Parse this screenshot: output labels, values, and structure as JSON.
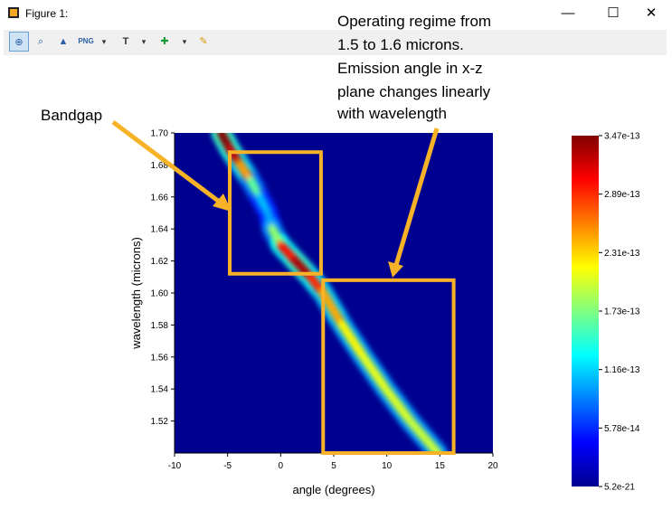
{
  "window": {
    "title": "Figure 1:",
    "minimize_glyph": "—",
    "maximize_glyph": "☐",
    "close_glyph": "✕"
  },
  "toolbar": {
    "buttons": [
      {
        "icon": "zoom-icon",
        "glyph": "⊕",
        "active": true
      },
      {
        "icon": "zoom-rect-icon",
        "glyph": "⌕",
        "active": false
      },
      {
        "icon": "mountain-icon",
        "glyph": "▲",
        "active": false
      },
      {
        "icon": "png-export-icon",
        "glyph": "PNG",
        "active": false,
        "dropdown": true
      },
      {
        "icon": "text-icon",
        "glyph": "T",
        "active": false,
        "dropdown": true
      },
      {
        "icon": "marker-icon",
        "glyph": "✚",
        "active": false,
        "dropdown": true
      },
      {
        "icon": "pencil-icon",
        "glyph": "✎",
        "active": false
      }
    ],
    "dropdown_glyph": "▾"
  },
  "chart_data": {
    "type": "heatmap",
    "title": "",
    "xlabel": "angle (degrees)",
    "ylabel": "wavelength (microns)",
    "xlim": [
      -10,
      20
    ],
    "ylim": [
      1.5,
      1.7
    ],
    "xticks": [
      "-10",
      "-5",
      "0",
      "5",
      "10",
      "15",
      "20"
    ],
    "yticks": [
      "1.52",
      "1.54",
      "1.56",
      "1.58",
      "1.60",
      "1.62",
      "1.64",
      "1.66",
      "1.68",
      "1.70"
    ],
    "colorbar": {
      "min": 5.2e-21,
      "max": 3.47e-13,
      "ticks": [
        "3.47e-13",
        "2.89e-13",
        "2.31e-13",
        "1.73e-13",
        "1.16e-13",
        "5.78e-14",
        "5.2e-21"
      ],
      "colormap": "jet"
    },
    "ridge": [
      {
        "wavelength": 1.7,
        "angle": -5.6,
        "intensity": 0.98
      },
      {
        "wavelength": 1.69,
        "angle": -4.8,
        "intensity": 1.0
      },
      {
        "wavelength": 1.68,
        "angle": -3.8,
        "intensity": 0.85
      },
      {
        "wavelength": 1.67,
        "angle": -2.8,
        "intensity": 0.55
      },
      {
        "wavelength": 1.66,
        "angle": -2.0,
        "intensity": 0.3
      },
      {
        "wavelength": 1.65,
        "angle": -1.2,
        "intensity": 0.2
      },
      {
        "wavelength": 1.64,
        "angle": -0.8,
        "intensity": 0.25
      },
      {
        "wavelength": 1.63,
        "angle": 0.0,
        "intensity": 0.7
      },
      {
        "wavelength": 1.62,
        "angle": 1.4,
        "intensity": 1.0
      },
      {
        "wavelength": 1.61,
        "angle": 2.8,
        "intensity": 0.9
      },
      {
        "wavelength": 1.6,
        "angle": 4.0,
        "intensity": 0.75
      },
      {
        "wavelength": 1.58,
        "angle": 5.8,
        "intensity": 0.62
      },
      {
        "wavelength": 1.56,
        "angle": 7.8,
        "intensity": 0.58
      },
      {
        "wavelength": 1.54,
        "angle": 9.9,
        "intensity": 0.56
      },
      {
        "wavelength": 1.52,
        "angle": 12.2,
        "intensity": 0.55
      },
      {
        "wavelength": 1.5,
        "angle": 14.8,
        "intensity": 0.52
      }
    ],
    "annotations": [
      {
        "text": "Bandgap",
        "box": {
          "angle_min": -4.8,
          "angle_max": 3.8,
          "wl_min": 1.612,
          "wl_max": 1.688
        }
      },
      {
        "text": "Operating regime from 1.5 to 1.6 microns. Emission angle in x-z plane changes linearly with wavelength",
        "box": {
          "angle_min": 4.0,
          "angle_max": 16.3,
          "wl_min": 1.5,
          "wl_max": 1.608
        }
      }
    ]
  },
  "annotation_text": {
    "bandgap": "Bandgap",
    "operating_lines": [
      "Operating regime from",
      "1.5 to 1.6 microns.",
      "Emission angle in x-z",
      "plane changes linearly",
      "with wavelength"
    ]
  },
  "colors": {
    "annotation": "#f7b228",
    "background_field": "#00008f",
    "toolbar": "#f0f0f0"
  }
}
